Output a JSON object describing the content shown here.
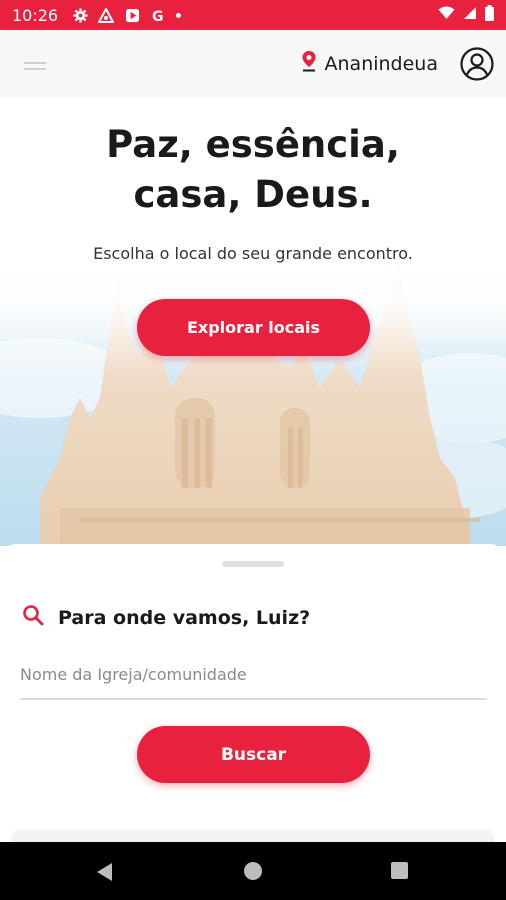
{
  "status_bar": {
    "time": "10:26",
    "icons": [
      "settings-icon",
      "vpn-icon",
      "play-store-icon",
      "google-icon",
      "dot-icon"
    ],
    "right_icons": [
      "wifi-icon",
      "signal-icon",
      "battery-icon"
    ],
    "accent_color": "#e8213e"
  },
  "header": {
    "location_label": "Ananindeua",
    "menu_icon": "menu-icon",
    "location_icon": "map-pin-icon",
    "profile_icon": "profile-icon"
  },
  "hero": {
    "title_line1": "Paz, essência,",
    "title_line2": "casa, Deus.",
    "subtitle": "Escolha o local do seu grande encontro.",
    "explore_button_label": "Explorar locais"
  },
  "search": {
    "heading": "Para onde vamos, Luiz?",
    "input_placeholder": "Nome da Igreja/comunidade",
    "input_value": "",
    "button_label": "Buscar"
  },
  "nav_bar": {
    "icons": [
      "back-icon",
      "home-icon",
      "recents-icon"
    ]
  }
}
